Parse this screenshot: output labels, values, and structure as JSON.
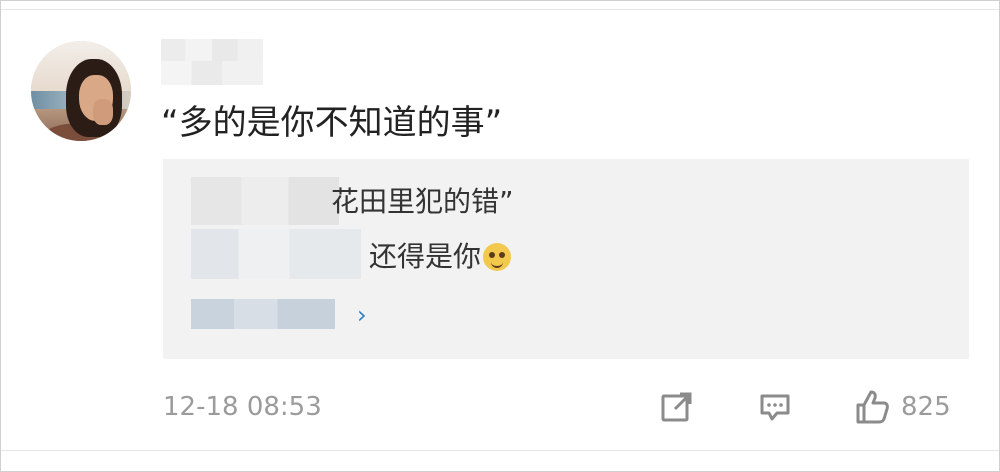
{
  "comment": {
    "text": "“多的是你不知道的事”"
  },
  "quoted_reply": {
    "line1": "花田里犯的错”",
    "line2": "还得是你",
    "emoji_icon": "doge-icon"
  },
  "footer": {
    "timestamp": "12-18 08:53",
    "like_count": "825"
  },
  "icons": {
    "share": "share-icon",
    "comment": "comment-icon",
    "like": "thumbs-up-icon",
    "chevron": "chevron-right-icon"
  },
  "colors": {
    "text_primary": "#222222",
    "text_secondary": "#9b9b9b",
    "reply_background": "#f2f2f2",
    "link_blue": "#2f7fc1"
  }
}
